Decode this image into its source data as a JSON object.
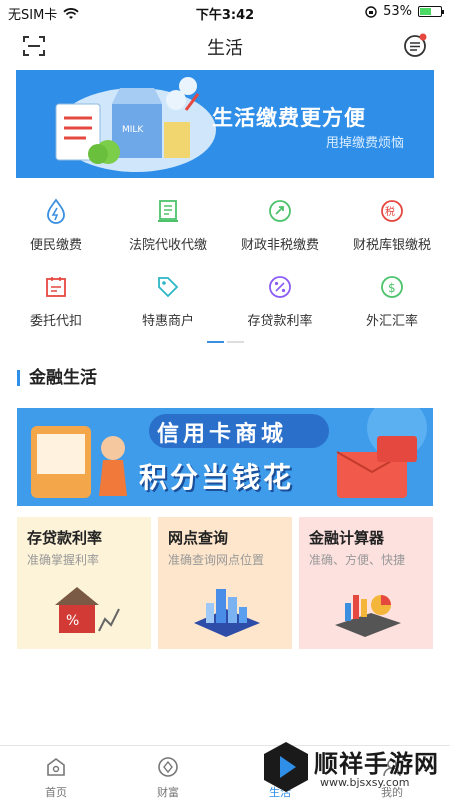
{
  "status": {
    "carrier": "无SIM卡",
    "time": "下午3:42",
    "battery": "53%",
    "battery_level": 0.53
  },
  "nav": {
    "title": "生活"
  },
  "banner": {
    "title": "生活缴费更方便",
    "subtitle": "甩掉缴费烦恼",
    "carton_label": "MILK"
  },
  "services": [
    {
      "label": "便民缴费",
      "icon": "water-drop-icon",
      "color": "#3a8fe0"
    },
    {
      "label": "法院代收代缴",
      "icon": "court-document-icon",
      "color": "#4cc36b"
    },
    {
      "label": "财政非税缴费",
      "icon": "finance-coin-icon",
      "color": "#4cc36b"
    },
    {
      "label": "财税库银缴税",
      "icon": "tax-icon",
      "color": "#e5483f"
    },
    {
      "label": "委托代扣",
      "icon": "entrust-card-icon",
      "color": "#e5483f"
    },
    {
      "label": "特惠商户",
      "icon": "discount-tag-icon",
      "color": "#2bb7c4"
    },
    {
      "label": "存贷款利率",
      "icon": "percent-icon",
      "color": "#8b5cf6"
    },
    {
      "label": "外汇汇率",
      "icon": "dollar-icon",
      "color": "#4cc36b"
    }
  ],
  "section": {
    "title": "金融生活"
  },
  "promo": {
    "line1": "信用卡商城",
    "line2": "积分当钱花"
  },
  "cards": [
    {
      "title": "存贷款利率",
      "subtitle": "准确掌握利率",
      "bg": "#fdf3d9"
    },
    {
      "title": "网点查询",
      "subtitle": "准确查询网点位置",
      "bg": "#fde6cc"
    },
    {
      "title": "金融计算器",
      "subtitle": "准确、方便、快捷",
      "bg": "#fde1df"
    }
  ],
  "tabs": [
    {
      "label": "首页",
      "icon": "home-icon",
      "active": false
    },
    {
      "label": "财富",
      "icon": "wealth-icon",
      "active": false
    },
    {
      "label": "生活",
      "icon": "life-icon",
      "active": true
    },
    {
      "label": "我的",
      "icon": "profile-icon",
      "active": false
    }
  ],
  "watermark": {
    "name": "顺祥手游网",
    "url": "www.bjsxsy.com"
  }
}
